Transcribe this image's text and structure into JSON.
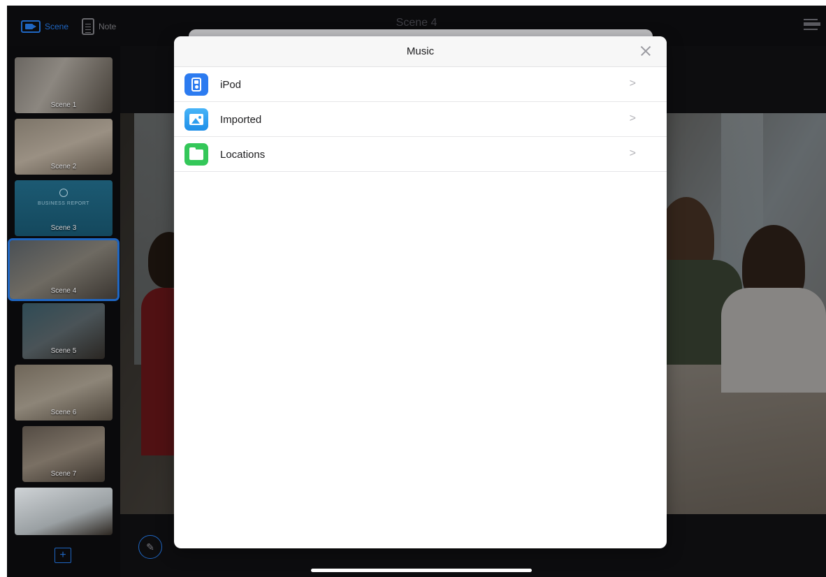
{
  "topbar": {
    "scene_label": "Scene",
    "note_label": "Note",
    "title": "Scene 4"
  },
  "sidebar": {
    "thumbnails": [
      {
        "label": "Scene 1"
      },
      {
        "label": "Scene 2"
      },
      {
        "label": "Scene 3",
        "title_text": "BUSINESS REPORT"
      },
      {
        "label": "Scene 4",
        "active": true
      },
      {
        "label": "Scene 5"
      },
      {
        "label": "Scene 6"
      },
      {
        "label": "Scene 7"
      },
      {
        "label": ""
      }
    ],
    "add_label": "+"
  },
  "modal": {
    "title": "Music",
    "items": [
      {
        "label": "iPod",
        "icon": "ipod-icon",
        "color": "#2c7bf0"
      },
      {
        "label": "Imported",
        "icon": "imported-photo-icon",
        "color": "#2e9ff0"
      },
      {
        "label": "Locations",
        "icon": "folder-icon",
        "color": "#34c759"
      }
    ],
    "chevron": ">"
  },
  "colors": {
    "accent": "#1f66c2",
    "background": "#0d0d0f"
  }
}
